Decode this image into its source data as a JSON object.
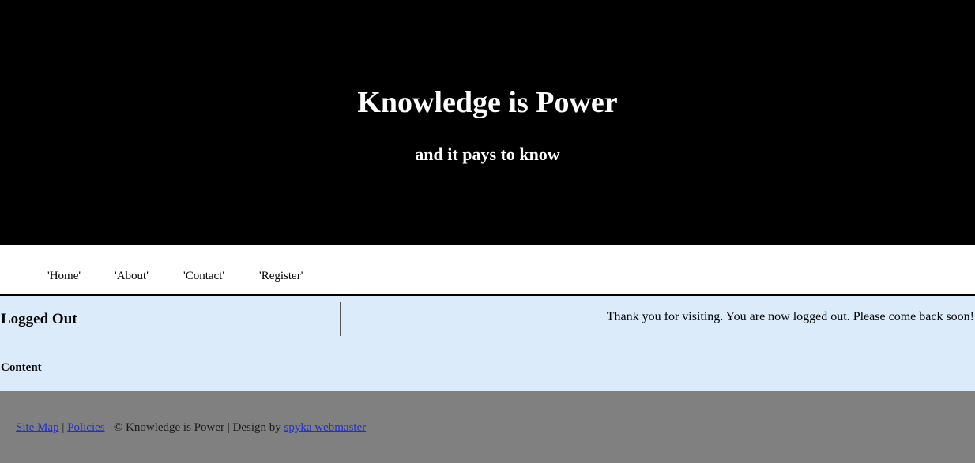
{
  "header": {
    "title": "Knowledge is Power",
    "tagline": "and it pays to know"
  },
  "nav": {
    "items": [
      {
        "label": "'Home'"
      },
      {
        "label": "'About'"
      },
      {
        "label": "'Contact'"
      },
      {
        "label": "'Register'"
      }
    ]
  },
  "main": {
    "heading": "Logged Out",
    "content_heading": "Content",
    "message": "Thank you for visiting. You are now logged out. Please come back soon!"
  },
  "footer": {
    "site_map": "Site Map",
    "separator": "|",
    "policies": "Policies",
    "copyright": "© Knowledge is Power",
    "separator2": "|",
    "design_by": "Design by",
    "designer": "spyka webmaster"
  },
  "colors": {
    "header_bg": "#000000",
    "main_bg": "#dcebfa",
    "footer_bg": "#808080",
    "link": "#1f2fd6"
  }
}
